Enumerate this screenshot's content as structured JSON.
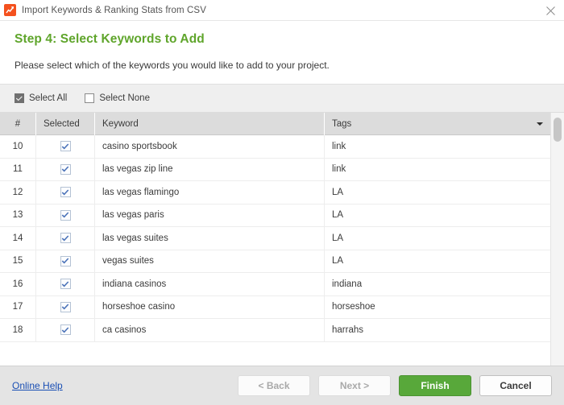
{
  "window": {
    "title": "Import Keywords & Ranking Stats from CSV",
    "app_icon": "chart-arrow-icon",
    "close_icon": "close-icon"
  },
  "header": {
    "step_title": "Step 4:  Select Keywords to Add",
    "description": "Please select which of the keywords you would like to add to your project."
  },
  "selectbar": {
    "select_all_label": "Select All",
    "select_all_checked": true,
    "select_none_label": "Select None",
    "select_none_checked": false
  },
  "table": {
    "columns": {
      "num": "#",
      "selected": "Selected",
      "keyword": "Keyword",
      "tags": "Tags"
    },
    "tags_sort_icon": "chevron-down-icon",
    "rows": [
      {
        "num": "10",
        "checked": true,
        "keyword": "casino sportsbook",
        "tag": "link"
      },
      {
        "num": "11",
        "checked": true,
        "keyword": "las vegas zip line",
        "tag": "link"
      },
      {
        "num": "12",
        "checked": true,
        "keyword": "las vegas flamingo",
        "tag": "LA"
      },
      {
        "num": "13",
        "checked": true,
        "keyword": "las vegas paris",
        "tag": "LA"
      },
      {
        "num": "14",
        "checked": true,
        "keyword": "las vegas suites",
        "tag": "LA"
      },
      {
        "num": "15",
        "checked": true,
        "keyword": "vegas suites",
        "tag": "LA"
      },
      {
        "num": "16",
        "checked": true,
        "keyword": "indiana casinos",
        "tag": "indiana"
      },
      {
        "num": "17",
        "checked": true,
        "keyword": "horseshoe casino",
        "tag": "horseshoe"
      },
      {
        "num": "18",
        "checked": true,
        "keyword": "ca casinos",
        "tag": "harrahs"
      }
    ]
  },
  "footer": {
    "help_label": "Online Help",
    "back_label": "< Back",
    "back_disabled": true,
    "next_label": "Next >",
    "next_disabled": true,
    "finish_label": "Finish",
    "cancel_label": "Cancel"
  },
  "colors": {
    "accent_green": "#5fa52b",
    "finish_green": "#58a83a",
    "icon_orange": "#f4511e",
    "link_blue": "#1a4fb4",
    "header_gray": "#dcdcdc"
  }
}
